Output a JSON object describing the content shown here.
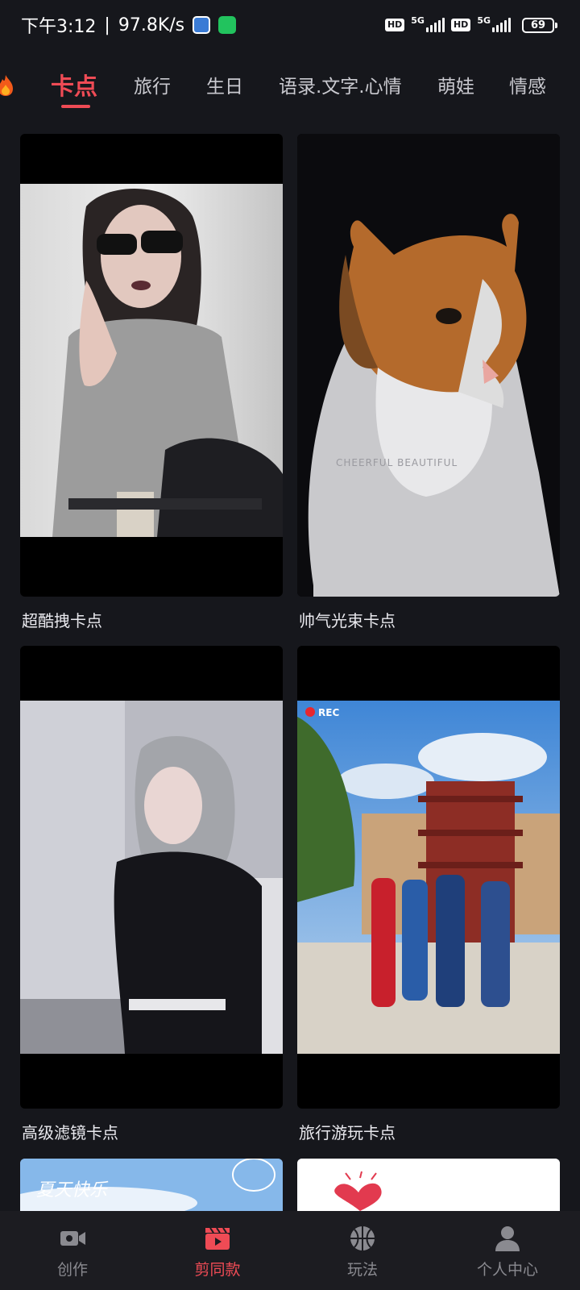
{
  "status_bar": {
    "time": "下午3:12",
    "separator": "|",
    "net_speed": "97.8K/s",
    "hd_badge_1": "HD",
    "net_type_1": "5G",
    "hd_badge_2": "HD",
    "net_type_2": "5G",
    "battery": "69",
    "app_icons": [
      "app-notification-icon",
      "wechat-icon"
    ]
  },
  "tabs": {
    "items": [
      "卡点",
      "旅行",
      "生日",
      "语录.文字.心情",
      "萌娃",
      "情感"
    ],
    "active_index": 0,
    "leading_icon": "fire-icon"
  },
  "templates": [
    {
      "title": "超酷拽卡点",
      "photo_text": ""
    },
    {
      "title": "帅气光束卡点",
      "photo_text": "CHEERFUL BEAUTIFUL"
    },
    {
      "title": "高级滤镜卡点",
      "photo_text": ""
    },
    {
      "title": "旅行游玩卡点",
      "photo_text": "REC"
    }
  ],
  "partial_templates": [
    {
      "photo_text": "夏天快乐"
    },
    {
      "photo_text": ""
    }
  ],
  "bottom_nav": {
    "items": [
      {
        "label": "创作",
        "icon": "video-camera-icon"
      },
      {
        "label": "剪同款",
        "icon": "clapperboard-icon"
      },
      {
        "label": "玩法",
        "icon": "basketball-icon"
      },
      {
        "label": "个人中心",
        "icon": "person-icon"
      }
    ],
    "active_index": 1
  },
  "colors": {
    "accent": "#ef4b55",
    "background": "#16171c",
    "nav_background": "#1c1c21"
  }
}
